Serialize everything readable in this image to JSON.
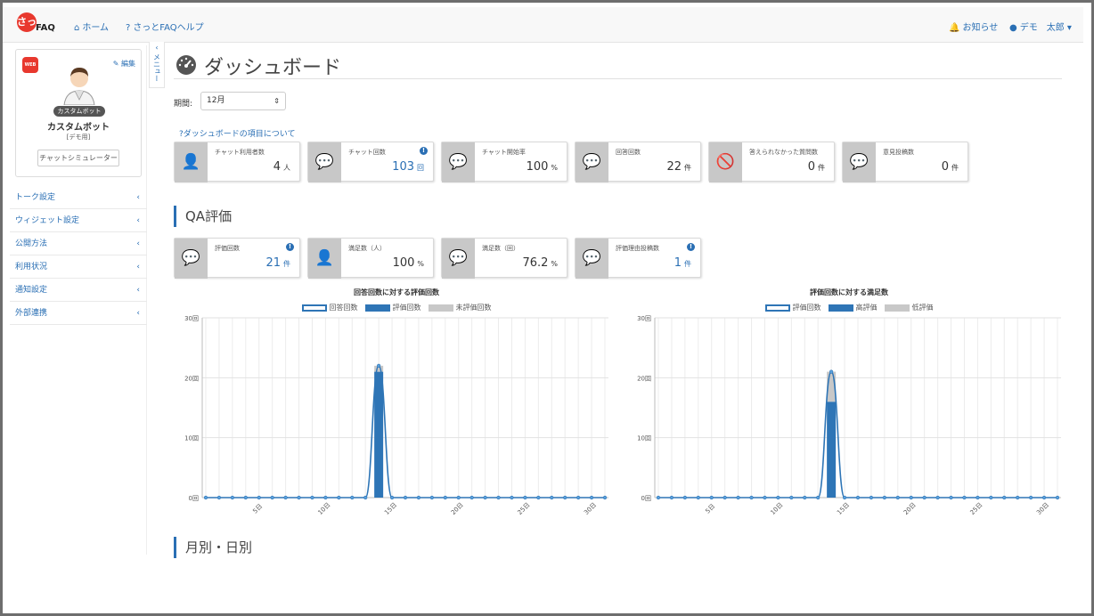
{
  "nav": {
    "logo_main": "さっ",
    "logo_sub": "FAQ",
    "home": "ホーム",
    "help": "さっとFAQヘルプ",
    "notice": "お知らせ",
    "user": "デモ　太郎"
  },
  "profile": {
    "web_badge": "WEB",
    "edit": "編集",
    "badge": "カスタムボット",
    "name": "カスタムボット",
    "sub": "[デモ用]",
    "simulator": "チャットシミュレーター"
  },
  "sidebar": {
    "collapse_label": "メニュー",
    "items": [
      {
        "label": "トーク設定"
      },
      {
        "label": "ウィジェット設定"
      },
      {
        "label": "公開方法"
      },
      {
        "label": "利用状況"
      },
      {
        "label": "通知設定"
      },
      {
        "label": "外部連携"
      }
    ]
  },
  "page": {
    "title": "ダッシュボード",
    "period_label": "期間:",
    "period_value": "12月",
    "about_link": "ダッシュボードの項目について",
    "qa_section": "QA評価",
    "monthly_section": "月別・日別"
  },
  "cards": [
    {
      "label": "チャット利用者数",
      "value": "4",
      "unit": "人",
      "icon": "user-icon",
      "info": false,
      "blue": false
    },
    {
      "label": "チャット回数",
      "value": "103",
      "unit": "回",
      "icon": "chats-icon",
      "info": true,
      "blue": true
    },
    {
      "label": "チャット開始率",
      "value": "100",
      "unit": "%",
      "icon": "chat-icon",
      "info": false,
      "blue": false
    },
    {
      "label": "回答回数",
      "value": "22",
      "unit": "件",
      "icon": "chat-icon",
      "info": false,
      "blue": false
    },
    {
      "label": "答えられなかった質問数",
      "value": "0",
      "unit": "件",
      "icon": "chat-off-icon",
      "info": false,
      "blue": false
    },
    {
      "label": "意見投稿数",
      "value": "0",
      "unit": "件",
      "icon": "chat-icon",
      "info": false,
      "blue": false
    }
  ],
  "qa_cards": [
    {
      "label": "評価回数",
      "value": "21",
      "unit": "件",
      "icon": "chat-icon",
      "info": true,
      "blue": true
    },
    {
      "label": "満足数（人）",
      "value": "100",
      "unit": "%",
      "icon": "user-icon",
      "info": false,
      "blue": false
    },
    {
      "label": "満足数（回）",
      "value": "76.2",
      "unit": "%",
      "icon": "chat-icon",
      "info": false,
      "blue": false
    },
    {
      "label": "評価理由投稿数",
      "value": "1",
      "unit": "件",
      "icon": "chat-icon",
      "info": true,
      "blue": true
    }
  ],
  "colors": {
    "accent": "#2a6fb4",
    "bar": "#2e75b6",
    "grey": "#c8c8c8"
  },
  "chart_data": [
    {
      "type": "bar",
      "title": "回答回数に対する評価回数",
      "ylim": [
        0,
        30
      ],
      "y_ticks": [
        "0回",
        "10回",
        "20回",
        "30回"
      ],
      "x_ticks": [
        {
          "day": 5,
          "label": "5日"
        },
        {
          "day": 10,
          "label": "10日"
        },
        {
          "day": 15,
          "label": "15日"
        },
        {
          "day": 20,
          "label": "20日"
        },
        {
          "day": 25,
          "label": "25日"
        },
        {
          "day": 30,
          "label": "30日"
        }
      ],
      "days": 31,
      "grid": true,
      "legend_position": "top",
      "series": [
        {
          "name": "回答回数",
          "style": "line",
          "values": [
            0,
            0,
            0,
            0,
            0,
            0,
            0,
            0,
            0,
            0,
            0,
            0,
            0,
            22,
            0,
            0,
            0,
            0,
            0,
            0,
            0,
            0,
            0,
            0,
            0,
            0,
            0,
            0,
            0,
            0,
            0
          ]
        },
        {
          "name": "評価回数",
          "style": "bar-dark",
          "values": [
            0,
            0,
            0,
            0,
            0,
            0,
            0,
            0,
            0,
            0,
            0,
            0,
            0,
            21,
            0,
            0,
            0,
            0,
            0,
            0,
            0,
            0,
            0,
            0,
            0,
            0,
            0,
            0,
            0,
            0,
            0
          ]
        },
        {
          "name": "未評価回数",
          "style": "bar-light",
          "values": [
            0,
            0,
            0,
            0,
            0,
            0,
            0,
            0,
            0,
            0,
            0,
            0,
            0,
            1,
            0,
            0,
            0,
            0,
            0,
            0,
            0,
            0,
            0,
            0,
            0,
            0,
            0,
            0,
            0,
            0,
            0
          ]
        }
      ]
    },
    {
      "type": "bar",
      "title": "評価回数に対する満足数",
      "ylim": [
        0,
        30
      ],
      "y_ticks": [
        "0回",
        "10回",
        "20回",
        "30回"
      ],
      "x_ticks": [
        {
          "day": 5,
          "label": "5日"
        },
        {
          "day": 10,
          "label": "10日"
        },
        {
          "day": 15,
          "label": "15日"
        },
        {
          "day": 20,
          "label": "20日"
        },
        {
          "day": 25,
          "label": "25日"
        },
        {
          "day": 30,
          "label": "30日"
        }
      ],
      "days": 31,
      "grid": true,
      "legend_position": "top",
      "series": [
        {
          "name": "評価回数",
          "style": "line",
          "values": [
            0,
            0,
            0,
            0,
            0,
            0,
            0,
            0,
            0,
            0,
            0,
            0,
            0,
            21,
            0,
            0,
            0,
            0,
            0,
            0,
            0,
            0,
            0,
            0,
            0,
            0,
            0,
            0,
            0,
            0,
            0
          ]
        },
        {
          "name": "高評価",
          "style": "bar-dark",
          "values": [
            0,
            0,
            0,
            0,
            0,
            0,
            0,
            0,
            0,
            0,
            0,
            0,
            0,
            16,
            0,
            0,
            0,
            0,
            0,
            0,
            0,
            0,
            0,
            0,
            0,
            0,
            0,
            0,
            0,
            0,
            0
          ]
        },
        {
          "name": "低評価",
          "style": "bar-light",
          "values": [
            0,
            0,
            0,
            0,
            0,
            0,
            0,
            0,
            0,
            0,
            0,
            0,
            0,
            5,
            0,
            0,
            0,
            0,
            0,
            0,
            0,
            0,
            0,
            0,
            0,
            0,
            0,
            0,
            0,
            0,
            0
          ]
        }
      ]
    }
  ]
}
